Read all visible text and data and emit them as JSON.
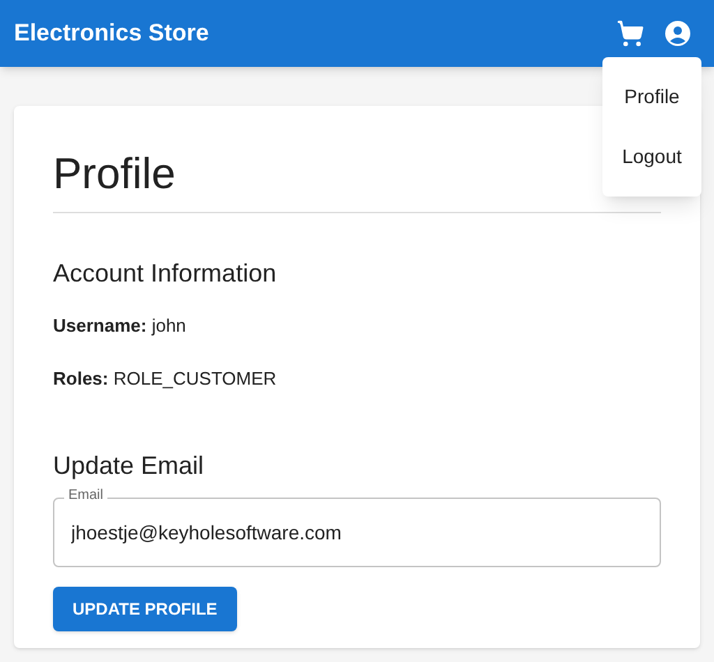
{
  "app_bar": {
    "title": "Electronics Store"
  },
  "account_menu": {
    "items": [
      "Profile",
      "Logout"
    ]
  },
  "page": {
    "title": "Profile",
    "account_information": {
      "heading": "Account Information",
      "fields": [
        {
          "label": "Username:",
          "value": "john"
        },
        {
          "label": "Roles:",
          "value": "ROLE_CUSTOMER"
        }
      ]
    },
    "update_email": {
      "heading": "Update Email",
      "email_field": {
        "label": "Email",
        "value": "jhoestje@keyholesoftware.com"
      },
      "button": "UPDATE PROFILE"
    }
  }
}
